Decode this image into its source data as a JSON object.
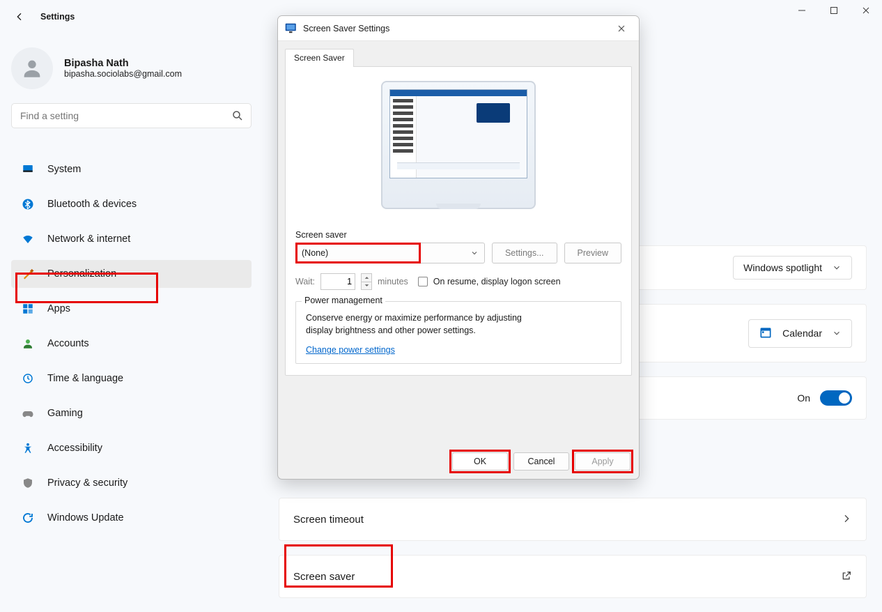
{
  "window": {
    "title": "Settings"
  },
  "user": {
    "name": "Bipasha Nath",
    "email": "bipasha.sociolabs@gmail.com"
  },
  "search": {
    "placeholder": "Find a setting"
  },
  "nav": {
    "items": [
      {
        "label": "System",
        "icon": "system"
      },
      {
        "label": "Bluetooth & devices",
        "icon": "bluetooth"
      },
      {
        "label": "Network & internet",
        "icon": "wifi"
      },
      {
        "label": "Personalization",
        "icon": "personalization"
      },
      {
        "label": "Apps",
        "icon": "apps"
      },
      {
        "label": "Accounts",
        "icon": "accounts"
      },
      {
        "label": "Time & language",
        "icon": "time"
      },
      {
        "label": "Gaming",
        "icon": "gaming"
      },
      {
        "label": "Accessibility",
        "icon": "accessibility"
      },
      {
        "label": "Privacy & security",
        "icon": "privacy"
      },
      {
        "label": "Windows Update",
        "icon": "update"
      }
    ],
    "active_index": 3,
    "highlight_index": 3
  },
  "content": {
    "spotlight_card": {
      "dropdown_label": "Windows spotlight"
    },
    "calendar_card": {
      "dropdown_label": "Calendar"
    },
    "lockscreen_card": {
      "status_label": "On"
    },
    "timeout_card": {
      "title": "Screen timeout"
    },
    "screensaver_card": {
      "title": "Screen saver"
    }
  },
  "dialog": {
    "title": "Screen Saver Settings",
    "tab_label": "Screen Saver",
    "field_label": "Screen saver",
    "selected_option": "(None)",
    "settings_button": "Settings...",
    "preview_button": "Preview",
    "wait_label": "Wait:",
    "wait_value": "1",
    "wait_unit": "minutes",
    "resume_label": "On resume, display logon screen",
    "group_title": "Power management",
    "group_text1": "Conserve energy or maximize performance by adjusting",
    "group_text2": "display brightness and other power settings.",
    "power_link": "Change power settings",
    "ok_label": "OK",
    "cancel_label": "Cancel",
    "apply_label": "Apply",
    "highlights": {
      "select": true,
      "ok": true,
      "apply": true
    }
  },
  "highlights": {
    "screensaver_card": true
  }
}
